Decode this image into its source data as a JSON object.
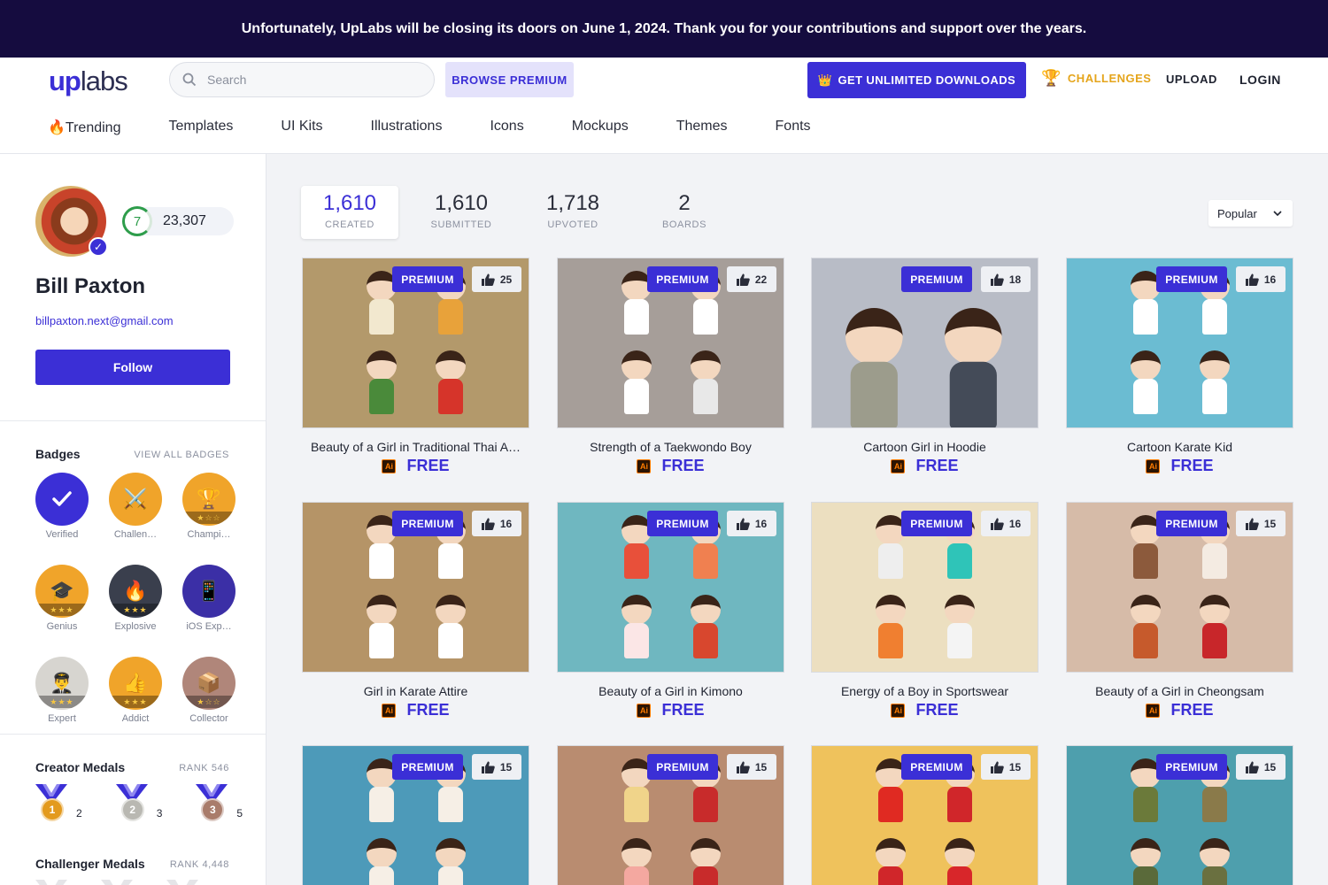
{
  "banner": {
    "text": "Unfortunately, UpLabs will be closing its doors on June 1, 2024. Thank you for your contributions and support over the years."
  },
  "header": {
    "logo_up": "up",
    "logo_labs": "labs",
    "search_placeholder": "Search",
    "browse_premium": "BROWSE PREMIUM",
    "get_unlimited": "GET UNLIMITED DOWNLOADS",
    "challenges": "CHALLENGES",
    "upload": "UPLOAD",
    "login": "LOGIN",
    "nav": [
      "🔥Trending",
      "Templates",
      "UI Kits",
      "Illustrations",
      "Icons",
      "Mockups",
      "Themes",
      "Fonts"
    ]
  },
  "profile": {
    "level": "7",
    "points": "23,307",
    "name": "Bill Paxton",
    "email": "billpaxton.next@gmail.com",
    "follow": "Follow",
    "badges_title": "Badges",
    "view_all_badges": "VIEW ALL BADGES",
    "badges": [
      {
        "label": "Verified",
        "icon": "check-icon",
        "color": "#3b2fd6"
      },
      {
        "label": "Challen…",
        "icon": "swords-icon",
        "color": "#f0a42a"
      },
      {
        "label": "Champi…",
        "icon": "trophy-icon",
        "color": "#f0a42a"
      },
      {
        "label": "Genius",
        "icon": "graduation-cap-icon",
        "color": "#f0a42a"
      },
      {
        "label": "Explosive",
        "icon": "fire-icon",
        "color": "#3a3f4d"
      },
      {
        "label": "iOS Exp…",
        "icon": "phone-icon",
        "color": "#3b2fa6"
      },
      {
        "label": "Expert",
        "icon": "expert-icon",
        "color": "#d7d5d0"
      },
      {
        "label": "Addict",
        "icon": "thumbs-up-icon",
        "color": "#f0a42a"
      },
      {
        "label": "Collector",
        "icon": "box-icon",
        "color": "#b0867a"
      }
    ],
    "creator_medals_title": "Creator Medals",
    "creator_rank": "RANK 546",
    "creator_medals": [
      {
        "place": "1",
        "count": "2",
        "color": "#e39a1e"
      },
      {
        "place": "2",
        "count": "3",
        "color": "#b9b8b2"
      },
      {
        "place": "3",
        "count": "5",
        "color": "#a97c6b"
      }
    ],
    "challenger_medals_title": "Challenger Medals",
    "challenger_rank": "RANK 4,448"
  },
  "stats": [
    {
      "value": "1,610",
      "label": "CREATED"
    },
    {
      "value": "1,610",
      "label": "SUBMITTED"
    },
    {
      "value": "1,718",
      "label": "UPVOTED"
    },
    {
      "value": "2",
      "label": "BOARDS"
    }
  ],
  "sort": {
    "value": "Popular"
  },
  "cards": [
    {
      "title": "Beauty of a Girl in Traditional Thai A…",
      "likes": "25",
      "bg": "#b3996b",
      "tag": "PREMIUM",
      "price": "FREE",
      "outfit": [
        "#f2e8cf",
        "#e8a23a",
        "#4a8a3a",
        "#d6342a"
      ]
    },
    {
      "title": "Strength of a Taekwondo Boy",
      "likes": "22",
      "bg": "#a69e99",
      "tag": "PREMIUM",
      "price": "FREE",
      "outfit": [
        "#ffffff",
        "#ffffff",
        "#ffffff",
        "#e8e8e8"
      ]
    },
    {
      "title": "Cartoon Girl in Hoodie",
      "likes": "18",
      "bg": "#b8bcc6",
      "tag": "PREMIUM",
      "price": "FREE",
      "outfit": [
        "#9c9c8c",
        "#444b58"
      ]
    },
    {
      "title": "Cartoon Karate Kid",
      "likes": "16",
      "bg": "#6bbcd2",
      "tag": "PREMIUM",
      "price": "FREE",
      "outfit": [
        "#ffffff",
        "#ffffff",
        "#ffffff",
        "#ffffff"
      ]
    },
    {
      "title": "Girl in Karate Attire",
      "likes": "16",
      "bg": "#b59467",
      "tag": "PREMIUM",
      "price": "FREE",
      "outfit": [
        "#ffffff",
        "#ffffff",
        "#ffffff",
        "#ffffff"
      ]
    },
    {
      "title": "Beauty of a Girl in Kimono",
      "likes": "16",
      "bg": "#6fb7c0",
      "tag": "PREMIUM",
      "price": "FREE",
      "outfit": [
        "#e8503a",
        "#f08050",
        "#fbe6e6",
        "#d8472e"
      ]
    },
    {
      "title": "Energy of a Boy in Sportswear",
      "likes": "16",
      "bg": "#ecdfc0",
      "tag": "PREMIUM",
      "price": "FREE",
      "outfit": [
        "#eeeeee",
        "#2fc4b8",
        "#f07f30",
        "#f4f4f4"
      ]
    },
    {
      "title": "Beauty of a Girl in Cheongsam",
      "likes": "15",
      "bg": "#d6bba8",
      "tag": "PREMIUM",
      "price": "FREE",
      "outfit": [
        "#8c5a3c",
        "#f4ebe2",
        "#c65a2c",
        "#c8262a"
      ]
    },
    {
      "title": "",
      "likes": "15",
      "bg": "#4d9ab9",
      "tag": "PREMIUM",
      "price": "",
      "outfit": [
        "#f6efe6",
        "#f6efe6",
        "#f6efe6",
        "#f6efe6"
      ]
    },
    {
      "title": "",
      "likes": "15",
      "bg": "#b98c70",
      "tag": "PREMIUM",
      "price": "",
      "outfit": [
        "#f0d48a",
        "#c82b2b",
        "#f4a8a0",
        "#c82b2b"
      ]
    },
    {
      "title": "",
      "likes": "15",
      "bg": "#efc25c",
      "tag": "PREMIUM",
      "price": "",
      "outfit": [
        "#e02a22",
        "#d0262a",
        "#d0262a",
        "#d8262a"
      ]
    },
    {
      "title": "",
      "likes": "15",
      "bg": "#4e9fad",
      "tag": "PREMIUM",
      "price": "",
      "outfit": [
        "#6b7a3a",
        "#8a7a4a",
        "#5a6a3a",
        "#6a7040"
      ]
    }
  ]
}
